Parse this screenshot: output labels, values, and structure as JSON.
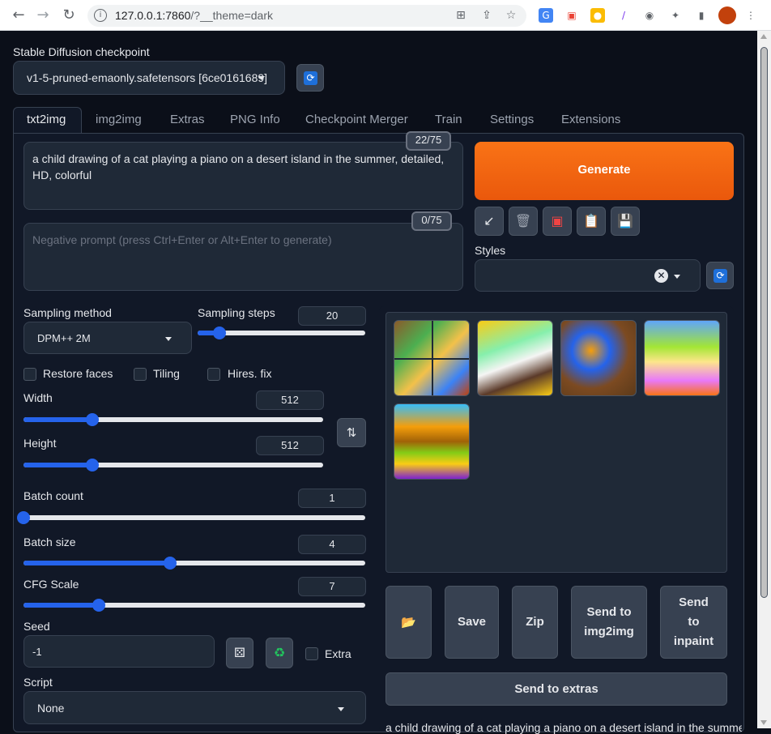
{
  "browser": {
    "url_host": "127.0.0.1:7860",
    "url_path": "/?__theme=dark"
  },
  "checkpoint": {
    "label": "Stable Diffusion checkpoint",
    "value": "v1-5-pruned-emaonly.safetensors [6ce0161689]"
  },
  "tabs": [
    "txt2img",
    "img2img",
    "Extras",
    "PNG Info",
    "Checkpoint Merger",
    "Train",
    "Settings",
    "Extensions"
  ],
  "prompt": {
    "text": "a child drawing of a cat playing a piano on a desert island in the summer, detailed, HD, colorful",
    "counter": "22/75"
  },
  "negative_prompt": {
    "placeholder": "Negative prompt (press Ctrl+Enter or Alt+Enter to generate)",
    "counter": "0/75"
  },
  "generate_label": "Generate",
  "styles_label": "Styles",
  "sampling": {
    "method_label": "Sampling method",
    "method_value": "DPM++ 2M",
    "steps_label": "Sampling steps",
    "steps_value": "20",
    "steps_fraction": 0.13
  },
  "checkboxes": {
    "restore_faces": "Restore faces",
    "tiling": "Tiling",
    "hires_fix": "Hires. fix"
  },
  "width": {
    "label": "Width",
    "value": "512",
    "fraction": 0.23
  },
  "height": {
    "label": "Height",
    "value": "512",
    "fraction": 0.23
  },
  "batch_count": {
    "label": "Batch count",
    "value": "1",
    "fraction": 0.0
  },
  "batch_size": {
    "label": "Batch size",
    "value": "4",
    "fraction": 0.43
  },
  "cfg_scale": {
    "label": "CFG Scale",
    "value": "7",
    "fraction": 0.22
  },
  "seed": {
    "label": "Seed",
    "value": "-1",
    "extra_label": "Extra"
  },
  "script": {
    "label": "Script",
    "value": "None"
  },
  "output_buttons": {
    "save": "Save",
    "zip": "Zip",
    "send_img2img": "Send to img2img",
    "send_inpaint": "Send to inpaint",
    "send_extras": "Send to extras"
  },
  "info_text": "a child drawing of a cat playing a piano on a desert island in the summer",
  "colors": {
    "background": "#0b0f19",
    "accent": "#f97316",
    "slider": "#2563eb"
  }
}
